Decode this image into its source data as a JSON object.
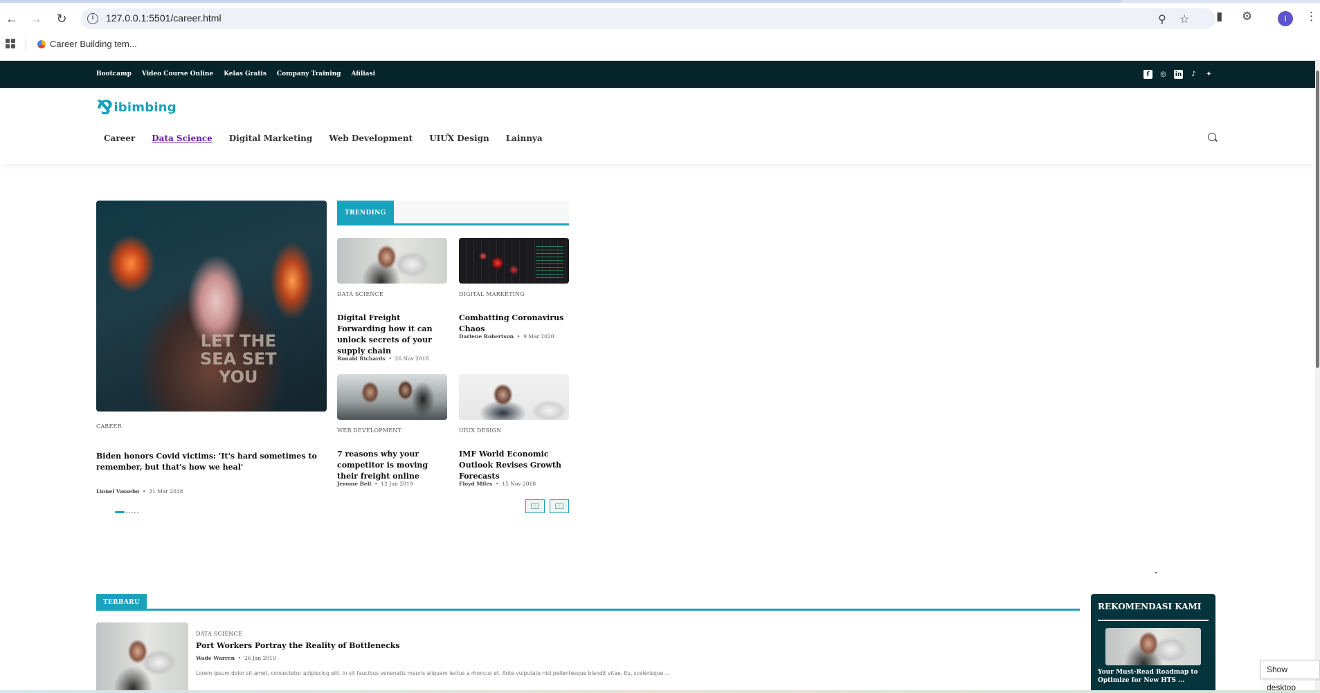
{
  "browser": {
    "url": "127.0.0.1:5501/career.html",
    "bookmark_label": "Career Building tem...",
    "profile_initial": "I"
  },
  "topbar": {
    "links": [
      "Bootcamp",
      "Video Course Online",
      "Kelas Gratis",
      "Company Training",
      "Afiliasi"
    ],
    "social_icons": [
      "facebook-icon",
      "instagram-icon",
      "linkedin-icon",
      "tiktok-icon",
      "twitter-icon"
    ]
  },
  "header": {
    "logo_text": "ibimbing",
    "nav": [
      "Career",
      "Data Science",
      "Digital Marketing",
      "Web Development",
      "UIUX Design",
      "Lainnya"
    ],
    "active_nav": "Data Science"
  },
  "featured": {
    "shirt_text": "LET THE\nSEA SET\nYOU",
    "category": "CAREER",
    "title": "Biden honors Covid victims: 'It's hard sometimes to remember, but that's how we heal'",
    "author": "Lionel Vassebo",
    "date": "31 Mar 2018"
  },
  "trending": {
    "heading": "TRENDING",
    "items": [
      {
        "category": "DATA SCIENCE",
        "title": "Digital Freight Forwarding how it can unlock secrets of your supply chain",
        "author": "Ronald Richards",
        "date": "26 Nov 2018"
      },
      {
        "category": "DIGITAL MARKETING",
        "title": "Combatting Coronavirus Chaos",
        "author": "Darlene Robertson",
        "date": "9 Mar 2020"
      },
      {
        "category": "WEB DEVELOPMENT",
        "title": "7 reasons why your competitor is moving their freight online",
        "author": "Jerome Bell",
        "date": "12 Jun 2019"
      },
      {
        "category": "UIUX DESIGN",
        "title": "IMF World Economic Outlook Revises Growth Forecasts",
        "author": "Floyd Miles",
        "date": "15 Nov 2018"
      }
    ]
  },
  "terbaru": {
    "heading": "TERBARU",
    "post": {
      "category": "DATA SCIENCE",
      "title": "Port Workers Portray the Reality of Bottlenecks",
      "author": "Wade Warren",
      "date": "26 Jan 2019",
      "excerpt": "Lorem ipsum dolor sit amet, consectetur adipiscing elit. In sit faucibus venenatis mauris aliquam lectus a rhoncus et. Ante vulputate nisl pellentesque blandit vitae. Eu, scelerisque ..."
    }
  },
  "rekomendasi": {
    "heading": "REKOMENDASI KAMI",
    "title": "Your Must-Read Roadmap to Optimize for New HTS ..."
  },
  "system": {
    "show_desktop": "Show desktop"
  }
}
